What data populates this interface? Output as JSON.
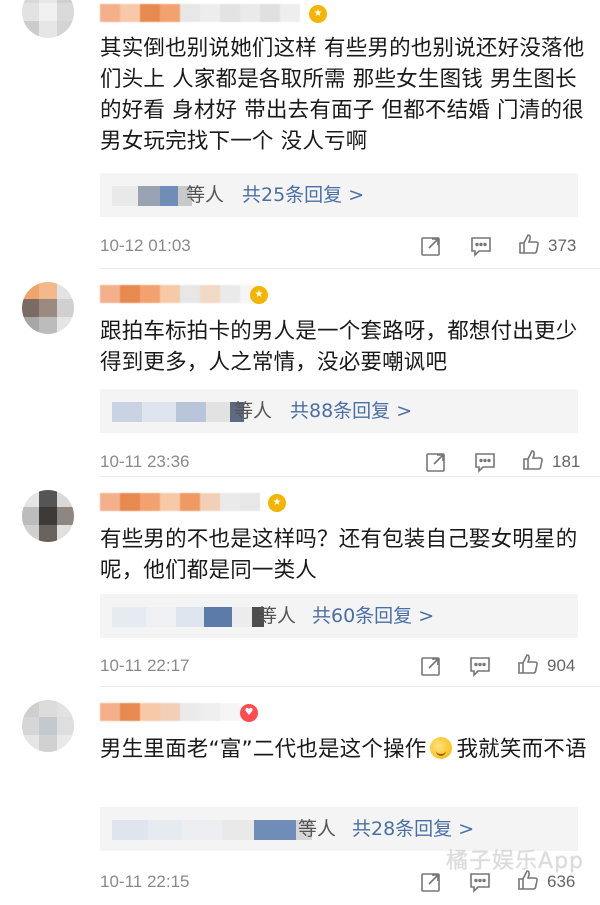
{
  "comments": [
    {
      "text": "其实倒也别说她们这样 有些男的也别说还好没落他们头上 人家都是各取所需 那些女生图钱 男生图长的好看 身材好 带出去有面子 但都不结婚 门清的很 男女玩完找下一个 没人亏啊",
      "reply_suffix": "等人",
      "reply_link": "共25条回复 >",
      "time": "10-12 01:03",
      "likes": "373"
    },
    {
      "text": "跟拍车标拍卡的男人是一个套路呀，都想付出更少得到更多，人之常情，没必要嘲讽吧",
      "reply_suffix": "等人",
      "reply_link": "共88条回复 >",
      "time": "10-11 23:36",
      "likes": "181"
    },
    {
      "text": "有些男的不也是这样吗？还有包装自己娶女明星的呢，他们都是同一类人",
      "reply_suffix": "等人",
      "reply_link": "共60条回复 >",
      "time": "10-11 22:17",
      "likes": "904"
    },
    {
      "text_before": "男生里面老“富”二代也是这个操作",
      "text_after": "我就笑而不语",
      "reply_suffix": "等人",
      "reply_link": "共28条回复 >",
      "time": "10-11 22:15",
      "likes": "636"
    }
  ],
  "icons": {
    "share": "share-icon",
    "comment": "comment-icon",
    "like": "thumbs-up-icon"
  },
  "watermark": "橘子娱乐App",
  "colors": {
    "link": "#4a6fa5",
    "meta": "#8a8a8a",
    "reply_bg": "#f4f4f4"
  }
}
